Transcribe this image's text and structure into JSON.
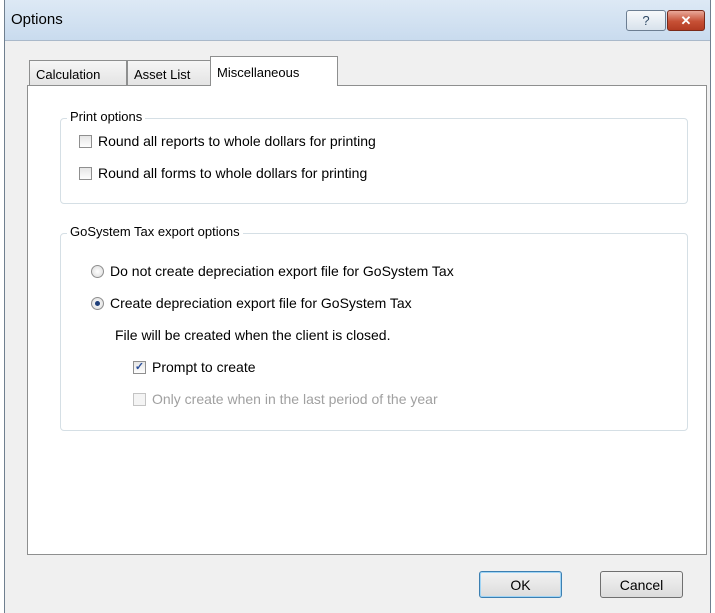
{
  "window": {
    "title": "Options",
    "help_label": "?",
    "close_label": "✕"
  },
  "tabs": [
    {
      "label": "Calculation",
      "active": false
    },
    {
      "label": "Asset List",
      "active": false
    },
    {
      "label": "Miscellaneous",
      "active": true
    }
  ],
  "print_options": {
    "legend": "Print options",
    "round_reports": {
      "label": "Round all reports to whole dollars for printing",
      "checked": false
    },
    "round_forms": {
      "label": "Round all forms to whole dollars for printing",
      "checked": false
    }
  },
  "export_options": {
    "legend": "GoSystem Tax export options",
    "no_export": {
      "label": "Do not create depreciation export file for GoSystem Tax",
      "selected": false
    },
    "create_export": {
      "label": "Create depreciation export file for GoSystem Tax",
      "selected": true
    },
    "note": "File will be created when the client is closed.",
    "prompt_to_create": {
      "label": "Prompt to create",
      "checked": true,
      "check_glyph": "✓"
    },
    "last_period_only": {
      "label": "Only create when in the last period of the year",
      "checked": false,
      "enabled": false
    }
  },
  "buttons": {
    "ok": "OK",
    "cancel": "Cancel"
  }
}
